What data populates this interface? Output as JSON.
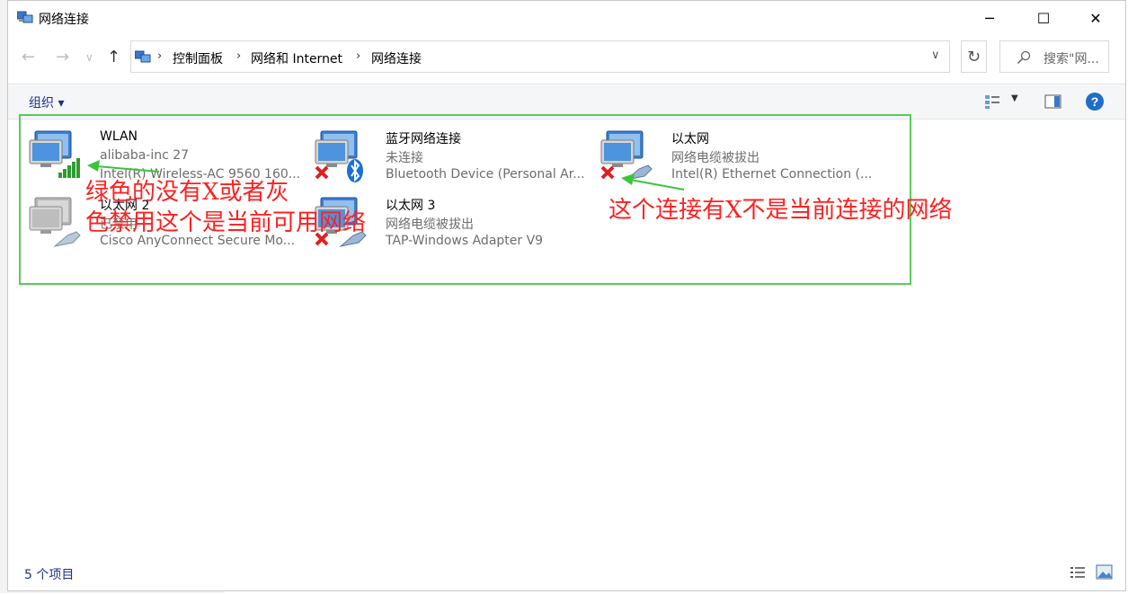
{
  "window": {
    "title": "网络连接",
    "minimize": "─",
    "maximize": "☐",
    "close": "✕"
  },
  "nav": {
    "back": "←",
    "forward": "→",
    "recent": "∨",
    "up": "↑",
    "refresh": "↻"
  },
  "breadcrumb": [
    "控制面板",
    "网络和 Internet",
    "网络连接"
  ],
  "breadcrumb_sep": "›",
  "search": {
    "placeholder": "搜索\"网..."
  },
  "toolbar": {
    "organize": "组织 ▾"
  },
  "connections": [
    {
      "name": "WLAN",
      "status": "alibaba-inc 27",
      "device": "Intel(R) Wireless-AC 9560 160...",
      "icon": "wifi-connected-icon"
    },
    {
      "name": "蓝牙网络连接",
      "status": "未连接",
      "device": "Bluetooth Device (Personal Ar...",
      "icon": "bluetooth-disconnected-icon"
    },
    {
      "name": "以太网",
      "status": "网络电缆被拔出",
      "device": "Intel(R) Ethernet Connection (...",
      "icon": "ethernet-disconnected-icon"
    },
    {
      "name": "以太网 2",
      "status": "已禁用",
      "device": "Cisco AnyConnect Secure Mo...",
      "icon": "ethernet-disabled-icon"
    },
    {
      "name": "以太网 3",
      "status": "网络电缆被拔出",
      "device": "TAP-Windows Adapter V9",
      "icon": "ethernet-disconnected-icon"
    }
  ],
  "annotations": {
    "left_line1": "绿色的没有X或者灰",
    "left_line2": "色禁用这个是当前可用网络",
    "right": "这个连接有X不是当前连接的网络"
  },
  "statusbar": {
    "count": "5 个项目"
  },
  "colors": {
    "annotation_red": "#ff2020",
    "annotation_green": "#5cc95c",
    "link_blue": "#1e3287"
  }
}
